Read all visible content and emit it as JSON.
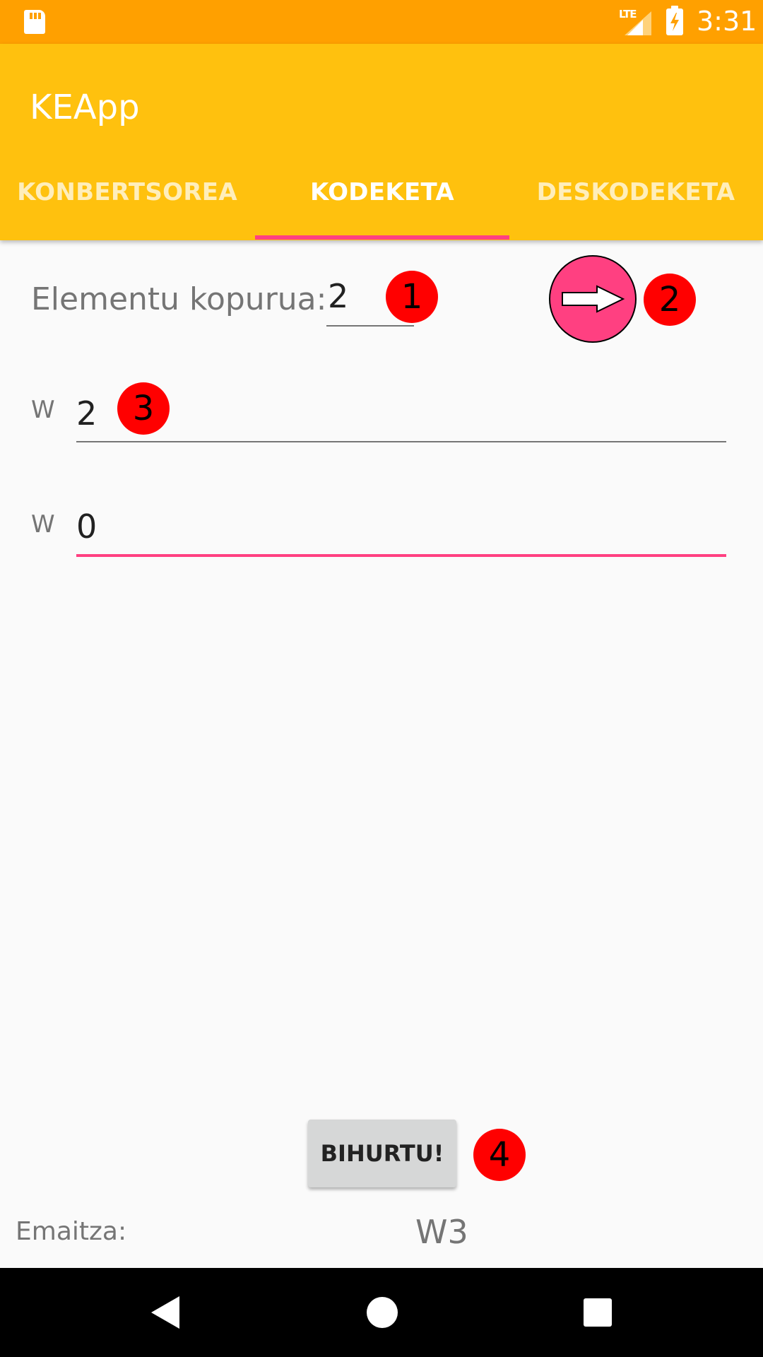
{
  "status_bar": {
    "network": "LTE",
    "time": "3:31",
    "icons": [
      "sd-card-icon",
      "signal-icon",
      "battery-charging-icon"
    ]
  },
  "app": {
    "title": "KEApp",
    "tabs": [
      {
        "label": "KONBERTSOREA",
        "selected": false
      },
      {
        "label": "KODEKETA",
        "selected": true
      },
      {
        "label": "DESKODEKETA",
        "selected": false
      }
    ],
    "colors": {
      "status": "#ffa000",
      "primary": "#ffc10e",
      "accent": "#ff4081"
    }
  },
  "form": {
    "count_label": "Elementu kopurua:",
    "count_value": "2",
    "next_button_icon": "arrow-right-icon",
    "weights": [
      {
        "label": "W",
        "value": "2"
      },
      {
        "label": "W",
        "value": "0"
      }
    ],
    "convert_label": "BIHURTU!"
  },
  "result": {
    "label": "Emaitza:",
    "value": "W3"
  },
  "annotations": [
    "1",
    "2",
    "3",
    "4"
  ],
  "nav_bar": {
    "icons": [
      "back-icon",
      "home-icon",
      "recents-icon"
    ]
  }
}
